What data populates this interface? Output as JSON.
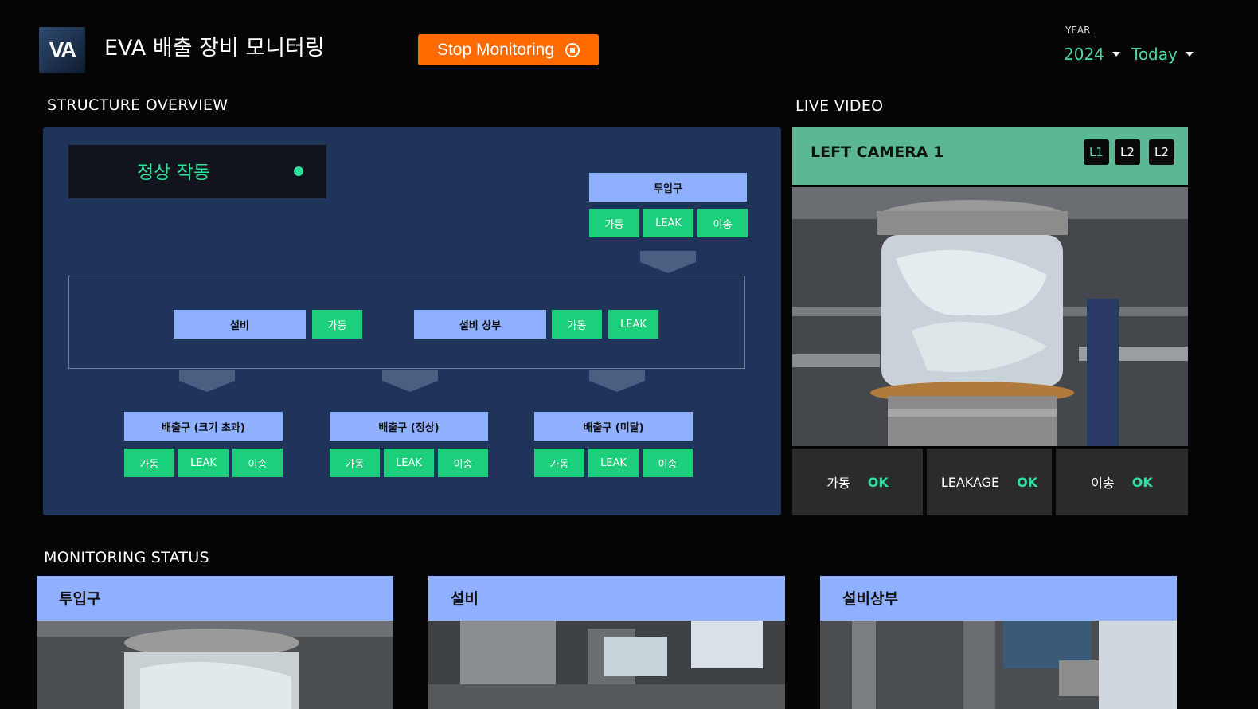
{
  "header": {
    "logo_text": "VA",
    "title": "EVA 배출 장비 모니터링",
    "stop_label": "Stop Monitoring",
    "year_label": "YEAR",
    "year_value": "2024",
    "period_value": "Today"
  },
  "structure": {
    "section_title": "STRUCTURE OVERVIEW",
    "status_text": "정상 작동",
    "status_color": "#2ee0a0",
    "input_node": {
      "label": "투입구",
      "tags": [
        "가동",
        "LEAK",
        "이송"
      ]
    },
    "equipment_node": {
      "label": "설비",
      "tags": [
        "가동"
      ]
    },
    "equipment_top_node": {
      "label": "설비 상부",
      "tags": [
        "가동",
        "LEAK"
      ]
    },
    "outlets": [
      {
        "label": "배출구 (크기 초과)",
        "tags": [
          "가동",
          "LEAK",
          "이송"
        ]
      },
      {
        "label": "배출구 (정상)",
        "tags": [
          "가동",
          "LEAK",
          "이송"
        ]
      },
      {
        "label": "배출구 (미달)",
        "tags": [
          "가동",
          "LEAK",
          "이송"
        ]
      }
    ]
  },
  "live": {
    "section_title": "LIVE VIDEO",
    "camera_title": "LEFT CAMERA 1",
    "camera_buttons": [
      "L1",
      "L2",
      "L2"
    ],
    "stats": [
      {
        "label": "가동",
        "value": "OK"
      },
      {
        "label": "LEAKAGE",
        "value": "OK"
      },
      {
        "label": "이송",
        "value": "OK"
      }
    ]
  },
  "monitoring": {
    "section_title": "MONITORING STATUS",
    "cards": [
      {
        "title": "투입구"
      },
      {
        "title": "설비"
      },
      {
        "title": "설비상부"
      }
    ]
  },
  "colors": {
    "accent_orange": "#ff6b00",
    "accent_green": "#2ee0a0",
    "node_blue": "#8fb0ff",
    "panel_navy": "#1e3459",
    "camera_header": "#5cb894"
  }
}
